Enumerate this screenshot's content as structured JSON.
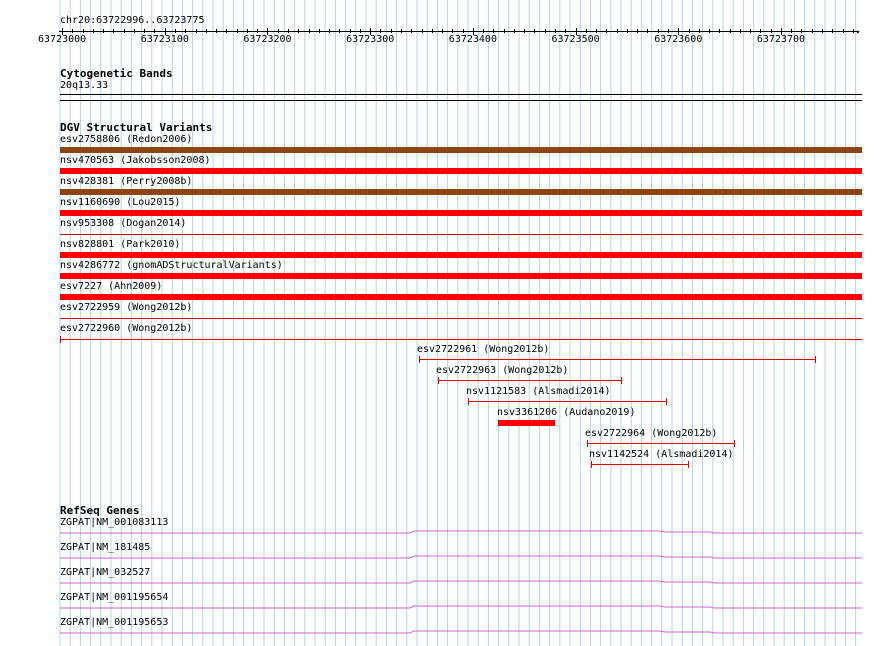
{
  "location": "chr20:63722996..63723775",
  "ruler": {
    "ticks": [
      "63723000",
      "63723100",
      "63723200",
      "63723300",
      "63723400",
      "63723500",
      "63723600",
      "63723700"
    ]
  },
  "cytogenetic": {
    "title": "Cytogenetic Bands",
    "band": "20q13.33"
  },
  "dgv": {
    "title": "DGV Structural Variants",
    "colors": {
      "loss": "#ff0000",
      "gain_loss": "#8b4513",
      "thin": "#e00000"
    },
    "full_rows": [
      {
        "label": "esv2758806 (Redon2006)",
        "kind": "gain_loss"
      },
      {
        "label": "nsv470563 (Jakobsson2008)",
        "kind": "loss"
      },
      {
        "label": "nsv428381 (Perry2008b)",
        "kind": "gain_loss"
      },
      {
        "label": "nsv1160690 (Lou2015)",
        "kind": "loss"
      },
      {
        "label": "nsv953308 (Dogan2014)",
        "kind": "thin"
      },
      {
        "label": "nsv828801 (Park2010)",
        "kind": "loss"
      },
      {
        "label": "nsv4286772 (gnomADStructuralVariants)",
        "kind": "loss"
      },
      {
        "label": "esv7227 (Ahn2009)",
        "kind": "loss"
      },
      {
        "label": "esv2722959 (Wong2012b)",
        "kind": "thin"
      },
      {
        "label": "esv2722960 (Wong2012b)",
        "kind": "thin_capped"
      }
    ],
    "partial_rows": [
      {
        "label": "esv2722961 (Wong2012b)",
        "kind": "thin"
      },
      {
        "label": "esv2722963 (Wong2012b)",
        "kind": "thin"
      },
      {
        "label": "nsv1121583 (Alsmadi2014)",
        "kind": "thin"
      },
      {
        "label": "nsv3361206 (Audano2019)",
        "kind": "thick"
      },
      {
        "label": "esv2722964 (Wong2012b)",
        "kind": "thin"
      },
      {
        "label": "nsv1142524 (Alsmadi2014)",
        "kind": "thin"
      }
    ]
  },
  "refseq": {
    "title": "RefSeq Genes",
    "color": "#cc66cc",
    "genes": [
      "ZGPAT|NM_001083113",
      "ZGPAT|NM_181485",
      "ZGPAT|NM_032527",
      "ZGPAT|NM_001195654",
      "ZGPAT|NM_001195653"
    ]
  }
}
